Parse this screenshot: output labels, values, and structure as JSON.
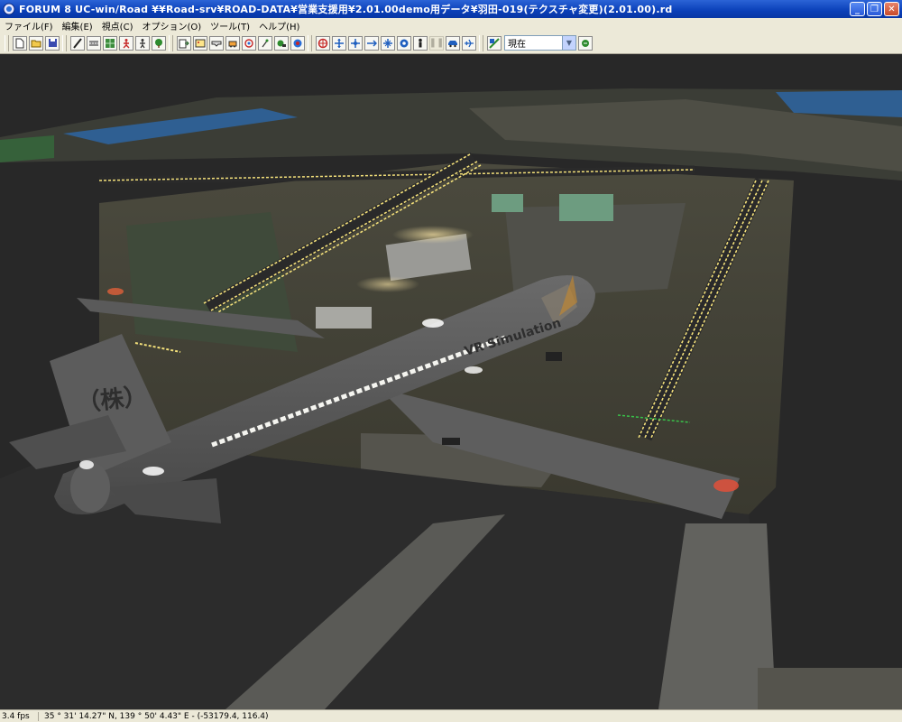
{
  "window": {
    "title": "FORUM 8    UC-win/Road    ¥¥Road-srv¥ROAD-DATA¥営業支援用¥2.01.00demo用データ¥羽田-019(テクスチャ変更)(2.01.00).rd",
    "minimize": "_",
    "maximize": "❐",
    "close": "✕"
  },
  "menu": {
    "items": [
      "ファイル(F)",
      "編集(E)",
      "視点(C)",
      "オプション(O)",
      "ツール(T)",
      "ヘルプ(H)"
    ]
  },
  "toolbar": {
    "icons": [
      "new-file-icon",
      "open-folder-icon",
      "save-icon",
      "road-icon",
      "road-definition-icon",
      "terrain-icon",
      "pedestrian-icon",
      "pedestrian-walk-icon",
      "tree-icon",
      "export-icon",
      "image-icon",
      "cross-section-icon",
      "model-icon",
      "rotate-icon",
      "plant-icon",
      "vehicle-icon",
      "target-icon",
      "walk-view-icon",
      "move-view-icon",
      "fly-view-icon",
      "orbit-icon",
      "look-icon",
      "person-icon",
      "pause-icon",
      "drive-car-icon",
      "airplane-icon",
      "camera-position-icon",
      "go-icon"
    ],
    "view_select": "現在"
  },
  "viewport": {
    "tail_mark": "（株）",
    "fuselage_text": "VR Simulation",
    "colors": {
      "sky": "#2b2b2b",
      "ground": "#3b3a34",
      "runway_light": "#f3e07a",
      "plane": "#6b6b6b",
      "water": "#3a6aa0"
    }
  },
  "status": {
    "fps": "3.4 fps",
    "coordinates": "35 °  31' 14.27\" N, 139 °  50' 4.43\" E  -  (-53179.4, 116.4)"
  }
}
